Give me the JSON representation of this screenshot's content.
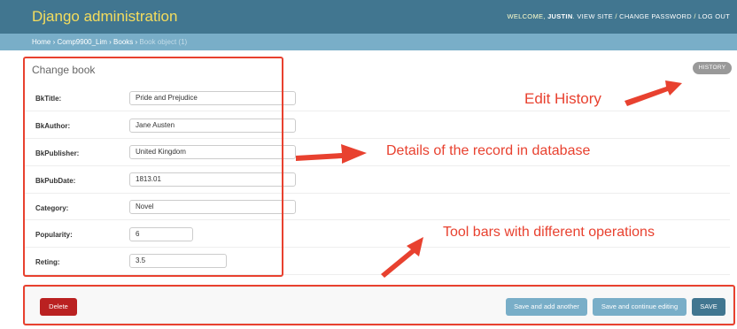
{
  "header": {
    "brand": "Django administration",
    "welcome_prefix": "WELCOME, ",
    "username": "JUSTIN",
    "welcome_suffix": ". ",
    "view_site": "VIEW SITE",
    "sep1": " / ",
    "change_password": "CHANGE PASSWORD",
    "sep2": " / ",
    "log_out": "LOG OUT"
  },
  "breadcrumbs": {
    "home": "Home",
    "sep": " › ",
    "app": "Comp9900_Lim",
    "model": "Books",
    "current": "Book object (1)"
  },
  "page": {
    "title": "Change book",
    "history_label": "HISTORY"
  },
  "fields": [
    {
      "label": "BkTitle:",
      "value": "Pride and Prejudice"
    },
    {
      "label": "BkAuthor:",
      "value": "Jane Austen"
    },
    {
      "label": "BkPublisher:",
      "value": "United Kingdom"
    },
    {
      "label": "BkPubDate:",
      "value": "1813.01"
    },
    {
      "label": "Category:",
      "value": "Novel"
    },
    {
      "label": "Popularity:",
      "value": "6"
    },
    {
      "label": "Reting:",
      "value": "3.5"
    }
  ],
  "toolbar": {
    "delete_label": "Delete",
    "save_add_label": "Save and add another",
    "save_continue_label": "Save and continue editing",
    "save_label": "SAVE"
  },
  "annotations": {
    "history": "Edit History",
    "details": "Details of the record in database",
    "toolbar": "Tool bars with different operations"
  },
  "colors": {
    "header_bg": "#417690",
    "brand": "#f5dd5d",
    "breadcrumbs_bg": "#79aec8",
    "delete": "#ba2121",
    "save": "#417690",
    "secondary_save": "#79aec8",
    "annotation": "#e8412f"
  }
}
